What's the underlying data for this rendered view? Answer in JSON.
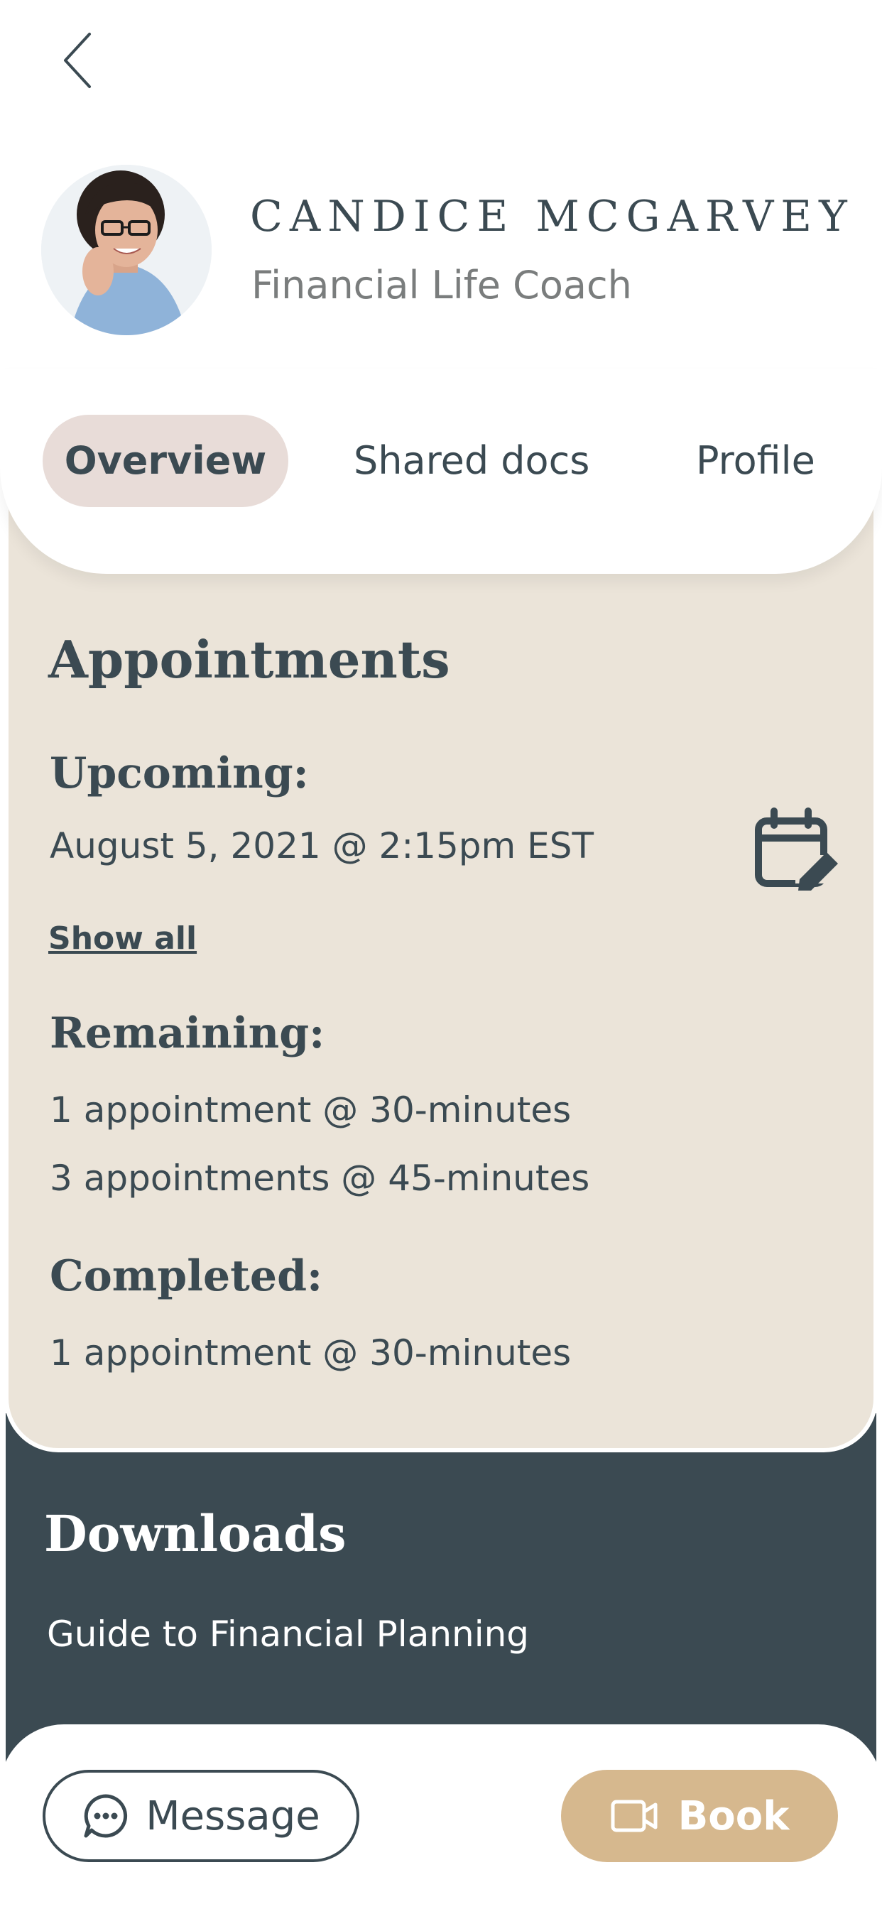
{
  "coach": {
    "name": "CANDICE MCGARVEY",
    "title": "Financial Life Coach"
  },
  "tabs": [
    {
      "label": "Overview",
      "active": true
    },
    {
      "label": "Shared docs",
      "active": false
    },
    {
      "label": "Profile",
      "active": false
    }
  ],
  "appointments": {
    "heading": "Appointments",
    "upcoming_label": "Upcoming:",
    "upcoming_value": "August 5, 2021 @ 2:15pm EST",
    "show_all": "Show all",
    "remaining_label": "Remaining:",
    "remaining_items": [
      "1 appointment @ 30-minutes",
      "3 appointments @ 45-minutes"
    ],
    "completed_label": "Completed:",
    "completed_items": [
      "1 appointment @ 30-minutes"
    ],
    "calendar_icon": "calendar-edit-icon"
  },
  "downloads": {
    "heading": "Downloads",
    "items": [
      "Guide to Financial Planning"
    ]
  },
  "actions": {
    "message_label": "Message",
    "book_label": "Book"
  },
  "icons": {
    "back": "chevron-left-icon",
    "message": "chat-bubble-icon",
    "book": "video-camera-icon"
  },
  "colors": {
    "text_dark": "#3b4a52",
    "muted": "#7a7d7d",
    "card_bg": "#ebe4d9",
    "tab_active_bg": "#e8dcd8",
    "downloads_bg": "#3b4a52",
    "book_bg": "#d6b88e"
  }
}
